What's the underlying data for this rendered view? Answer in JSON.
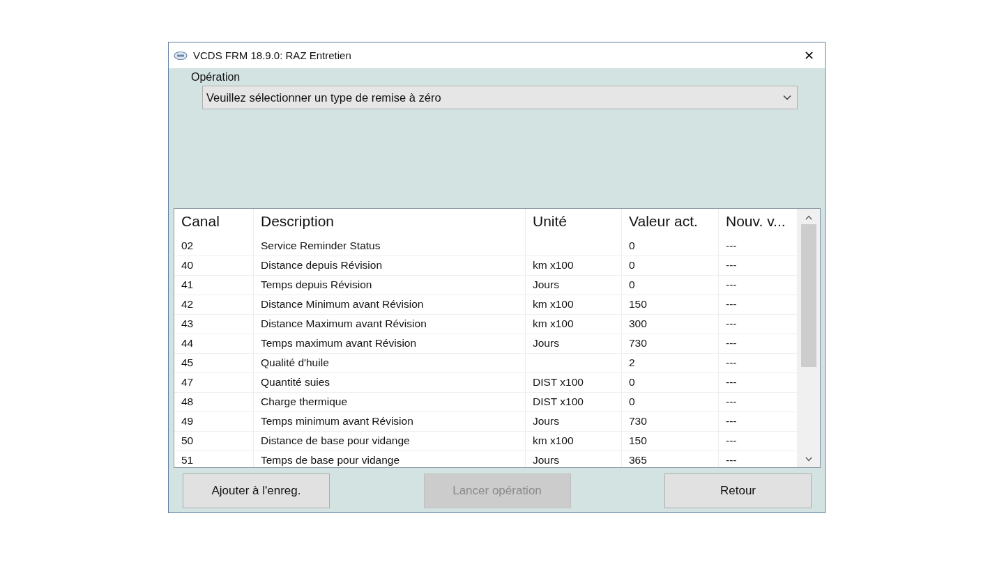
{
  "window": {
    "title": "VCDS FRM 18.9.0:  RAZ Entretien",
    "close": "✕"
  },
  "operation": {
    "label": "Opération",
    "value": "Veuillez sélectionner un type de remise à zéro"
  },
  "table": {
    "columns": [
      "Canal",
      "Description",
      "Unité",
      "Valeur act.",
      "Nouv. v..."
    ],
    "rows": [
      [
        "02",
        "Service Reminder Status",
        "",
        "0",
        "---"
      ],
      [
        "40",
        "Distance depuis Révision",
        "km x100",
        "0",
        "---"
      ],
      [
        "41",
        "Temps depuis Révision",
        "Jours",
        "0",
        "---"
      ],
      [
        "42",
        "Distance Minimum avant Révision",
        "km x100",
        "150",
        "---"
      ],
      [
        "43",
        "Distance Maximum avant Révision",
        "km x100",
        "300",
        "---"
      ],
      [
        "44",
        "Temps maximum avant Révision",
        "Jours",
        "730",
        "---"
      ],
      [
        "45",
        "Qualité d'huile",
        "",
        "2",
        "---"
      ],
      [
        "47",
        "Quantité suies",
        "DIST x100",
        "0",
        "---"
      ],
      [
        "48",
        "Charge thermique",
        "DIST x100",
        "0",
        "---"
      ],
      [
        "49",
        "Temps minimum avant Révision",
        "Jours",
        "730",
        "---"
      ],
      [
        "50",
        "Distance de base pour vidange",
        "km x100",
        "150",
        "---"
      ],
      [
        "51",
        "Temps de base pour vidange",
        "Jours",
        "365",
        "---"
      ]
    ]
  },
  "buttons": [
    {
      "label": "Ajouter à l'enreg.",
      "disabled": false
    },
    {
      "label": "Lancer opération",
      "disabled": true
    },
    {
      "label": "Retour",
      "disabled": false
    }
  ]
}
